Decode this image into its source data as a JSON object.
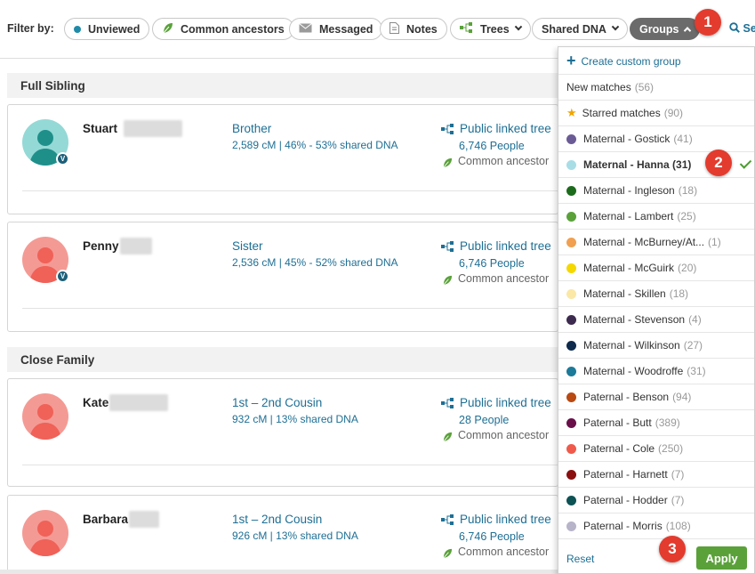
{
  "filter_bar": {
    "label": "Filter by:",
    "pills": [
      {
        "label": "Unviewed",
        "icon": "blue-dot-icon"
      },
      {
        "label": "Common ancestors",
        "icon": "leaf-icon"
      },
      {
        "label": "Messaged",
        "icon": "envelope-icon"
      },
      {
        "label": "Notes",
        "icon": "note-icon"
      },
      {
        "label": "Trees",
        "icon": "tree-icon"
      },
      {
        "label": "Shared DNA"
      },
      {
        "label": "Groups",
        "active": true
      }
    ],
    "search_label": "Se"
  },
  "callouts": [
    "1",
    "2",
    "3"
  ],
  "sections": [
    {
      "title": "Full Sibling",
      "cards": [
        {
          "name": "Stuart",
          "relationship": "Brother",
          "dna": "2,589 cM | 46% - 53% shared DNA",
          "tree": "Public linked tree",
          "people": "6,746 People",
          "common": "Common ancestor",
          "avatar_color": "#3dbab5",
          "verified": "V"
        },
        {
          "name": "Penny",
          "relationship": "Sister",
          "dna": "2,536 cM | 45% - 52% shared DNA",
          "tree": "Public linked tree",
          "people": "6,746 People",
          "common": "Common ancestor",
          "avatar_color": "#f0736d",
          "verified": "V"
        }
      ]
    },
    {
      "title": "Close Family",
      "cards": [
        {
          "name": "Kate",
          "relationship": "1st – 2nd Cousin",
          "dna": "932 cM | 13% shared DNA",
          "tree": "Public linked tree",
          "people": "28 People",
          "common": "Common ancestor",
          "avatar_color": "#f0736d"
        },
        {
          "name": "Barbara",
          "relationship": "1st – 2nd Cousin",
          "dna": "926 cM | 13% shared DNA",
          "tree": "Public linked tree",
          "people": "6,746 People",
          "common": "Common ancestor",
          "avatar_color": "#f0736d"
        }
      ]
    }
  ],
  "dropdown": {
    "create_label": "Create custom group",
    "new_matches": {
      "label": "New matches",
      "count": "(56)"
    },
    "starred": {
      "label": "Starred matches",
      "count": "(90)"
    },
    "groups": [
      {
        "label": "Maternal - Gostick",
        "count": "(41)",
        "color": "#6b5b95"
      },
      {
        "label": "Maternal - Hanna (31)",
        "count": "",
        "color": "#a8dde6",
        "selected": true
      },
      {
        "label": "Maternal - Ingleson",
        "count": "(18)",
        "color": "#1c6b1c"
      },
      {
        "label": "Maternal - Lambert",
        "count": "(25)",
        "color": "#5aa13a"
      },
      {
        "label": "Maternal - McBurney/At...",
        "count": "(1)",
        "color": "#f0a050"
      },
      {
        "label": "Maternal - McGuirk",
        "count": "(20)",
        "color": "#f5d800"
      },
      {
        "label": "Maternal - Skillen",
        "count": "(18)",
        "color": "#fbe8a6"
      },
      {
        "label": "Maternal - Stevenson",
        "count": "(4)",
        "color": "#3d2a4f"
      },
      {
        "label": "Maternal - Wilkinson",
        "count": "(27)",
        "color": "#0e2a4d"
      },
      {
        "label": "Maternal - Woodroffe",
        "count": "(31)",
        "color": "#1d7a99"
      },
      {
        "label": "Paternal - Benson",
        "count": "(94)",
        "color": "#b84a12"
      },
      {
        "label": "Paternal - Butt",
        "count": "(389)",
        "color": "#6a0f4a"
      },
      {
        "label": "Paternal - Cole",
        "count": "(250)",
        "color": "#f05a4a"
      },
      {
        "label": "Paternal - Harnett",
        "count": "(7)",
        "color": "#8b0f0f"
      },
      {
        "label": "Paternal - Hodder",
        "count": "(7)",
        "color": "#0d5254"
      },
      {
        "label": "Paternal - Morris",
        "count": "(108)",
        "color": "#b7b4c9"
      }
    ],
    "reset_label": "Reset",
    "apply_label": "Apply"
  },
  "colors": {
    "accent": "#1e6f94",
    "apply": "#5aa13a",
    "callout": "#e33b2e"
  }
}
